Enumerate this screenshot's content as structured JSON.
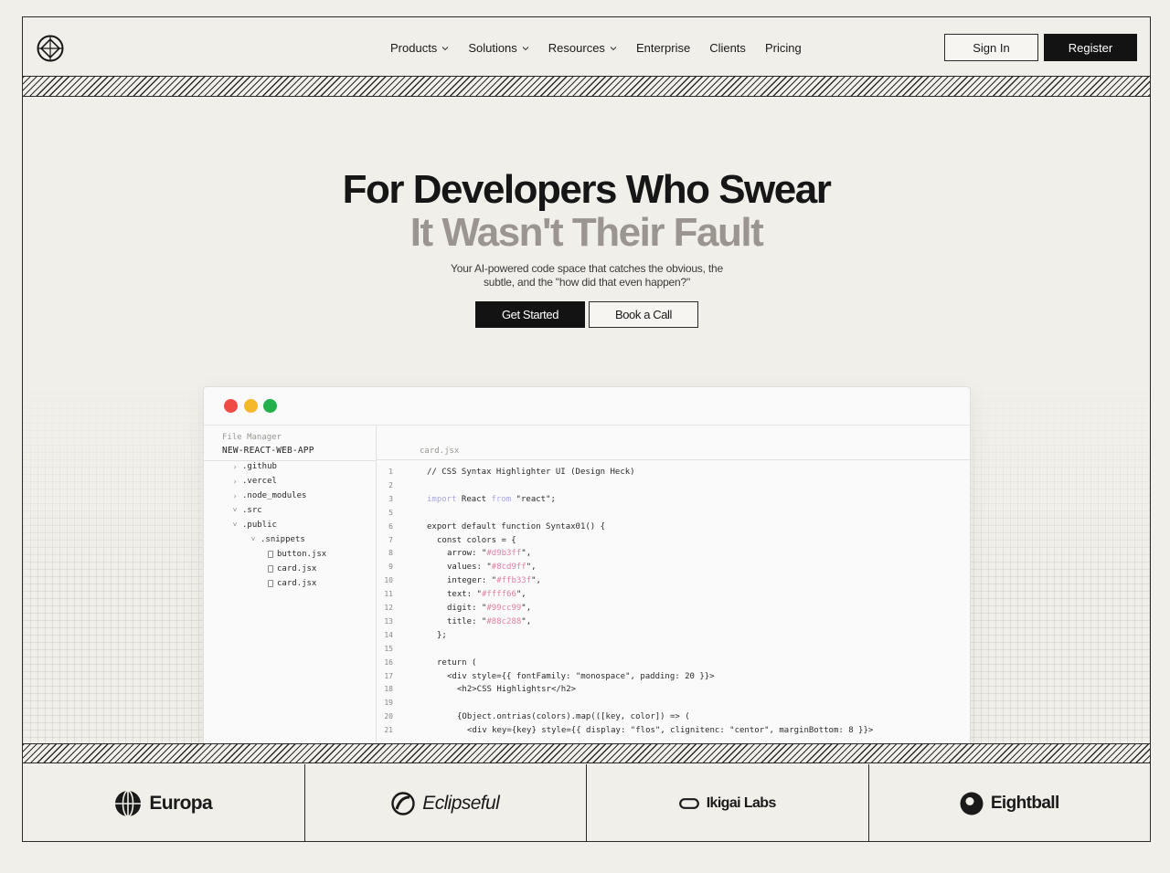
{
  "nav": {
    "items": [
      {
        "label": "Products",
        "has_dropdown": true
      },
      {
        "label": "Solutions",
        "has_dropdown": true
      },
      {
        "label": "Resources",
        "has_dropdown": true
      },
      {
        "label": "Enterprise",
        "has_dropdown": false
      },
      {
        "label": "Clients",
        "has_dropdown": false
      },
      {
        "label": "Pricing",
        "has_dropdown": false
      }
    ],
    "sign_in": "Sign In",
    "register": "Register"
  },
  "hero": {
    "headline": "For Developers Who Swear",
    "subline": "It Wasn't Their Fault",
    "description_line1": "Your AI-powered code space that catches the obvious, the",
    "description_line2": "subtle, and the \"how did that even happen?\"",
    "cta_primary": "Get Started",
    "cta_secondary": "Book a Call"
  },
  "editor": {
    "file_manager_label": "File Manager",
    "project_name": "NEW-REACT-WEB-APP",
    "tab": "card.jsx",
    "tree": [
      {
        "name": ".github",
        "type": "folder",
        "expanded": false,
        "depth": 0
      },
      {
        "name": ".vercel",
        "type": "folder",
        "expanded": false,
        "depth": 0
      },
      {
        "name": ".node_modules",
        "type": "folder",
        "expanded": false,
        "depth": 0
      },
      {
        "name": ".src",
        "type": "folder",
        "expanded": true,
        "depth": 0
      },
      {
        "name": ".public",
        "type": "folder",
        "expanded": true,
        "depth": 0
      },
      {
        "name": ".snippets",
        "type": "folder",
        "expanded": true,
        "depth": 1
      },
      {
        "name": "button.jsx",
        "type": "file",
        "depth": 2
      },
      {
        "name": "card.jsx",
        "type": "file",
        "depth": 2
      },
      {
        "name": "card.jsx",
        "type": "file",
        "depth": 2
      }
    ],
    "lines": [
      {
        "n": "1",
        "indent": 0,
        "parts": [
          {
            "t": "// CSS Syntax Highlighter UI (Design Heck)",
            "c": ""
          }
        ]
      },
      {
        "n": "2",
        "indent": 0,
        "parts": []
      },
      {
        "n": "3",
        "indent": 0,
        "parts": [
          {
            "t": "import",
            "c": "kw"
          },
          {
            "t": " React ",
            "c": ""
          },
          {
            "t": "from",
            "c": "kw"
          },
          {
            "t": " \"react\";",
            "c": ""
          }
        ]
      },
      {
        "n": "5",
        "indent": 0,
        "parts": []
      },
      {
        "n": "6",
        "indent": 0,
        "parts": [
          {
            "t": "export default function Syntax01() {",
            "c": ""
          }
        ]
      },
      {
        "n": "7",
        "indent": 1,
        "parts": [
          {
            "t": "const colors = {",
            "c": ""
          }
        ]
      },
      {
        "n": "8",
        "indent": 2,
        "parts": [
          {
            "t": "arrow: \"",
            "c": ""
          },
          {
            "t": "#d9b3ff",
            "c": "str"
          },
          {
            "t": "\",",
            "c": ""
          }
        ]
      },
      {
        "n": "9",
        "indent": 2,
        "parts": [
          {
            "t": "values: \"",
            "c": ""
          },
          {
            "t": "#8cd9ff",
            "c": "str"
          },
          {
            "t": "\",",
            "c": ""
          }
        ]
      },
      {
        "n": "10",
        "indent": 2,
        "parts": [
          {
            "t": "integer: \"",
            "c": ""
          },
          {
            "t": "#ffb33f",
            "c": "str"
          },
          {
            "t": "\",",
            "c": ""
          }
        ]
      },
      {
        "n": "11",
        "indent": 2,
        "parts": [
          {
            "t": "text: \"",
            "c": ""
          },
          {
            "t": "#ffff66",
            "c": "str"
          },
          {
            "t": "\",",
            "c": ""
          }
        ]
      },
      {
        "n": "12",
        "indent": 2,
        "parts": [
          {
            "t": "digit: \"",
            "c": ""
          },
          {
            "t": "#99cc99",
            "c": "str"
          },
          {
            "t": "\",",
            "c": ""
          }
        ]
      },
      {
        "n": "13",
        "indent": 2,
        "parts": [
          {
            "t": "title: \"",
            "c": ""
          },
          {
            "t": "#88c288",
            "c": "str"
          },
          {
            "t": "\",",
            "c": ""
          }
        ]
      },
      {
        "n": "14",
        "indent": 1,
        "parts": [
          {
            "t": "};",
            "c": ""
          }
        ]
      },
      {
        "n": "15",
        "indent": 0,
        "parts": []
      },
      {
        "n": "16",
        "indent": 1,
        "parts": [
          {
            "t": "return (",
            "c": ""
          }
        ]
      },
      {
        "n": "17",
        "indent": 2,
        "parts": [
          {
            "t": "<div style={{ fontFamily: \"monospace\", padding: 20 }}>",
            "c": ""
          }
        ]
      },
      {
        "n": "18",
        "indent": 3,
        "parts": [
          {
            "t": "<h2>CSS Highlightsr</h2>",
            "c": ""
          }
        ]
      },
      {
        "n": "19",
        "indent": 0,
        "parts": []
      },
      {
        "n": "20",
        "indent": 3,
        "parts": [
          {
            "t": "{Object.ontrias(colors).map(([key, color]) => (",
            "c": ""
          }
        ]
      },
      {
        "n": "21",
        "indent": 4,
        "parts": [
          {
            "t": "<div key={key} style={{ display: \"flos\", clignitenc: \"centor\", marginBottom: 8 }}>",
            "c": ""
          }
        ]
      }
    ]
  },
  "clients": [
    {
      "name": "Europa",
      "icon": "globe-icon"
    },
    {
      "name": "Eclipseful",
      "icon": "eclipse-icon"
    },
    {
      "name": "Ikigai Labs",
      "icon": "pill-icon"
    },
    {
      "name": "Eightball",
      "icon": "eightball-icon"
    }
  ],
  "colors": {
    "background": "#f1efea",
    "ink": "#131313",
    "subline": "#9a958e",
    "keyword": "#a9a6e0",
    "string": "#e07fa5"
  }
}
